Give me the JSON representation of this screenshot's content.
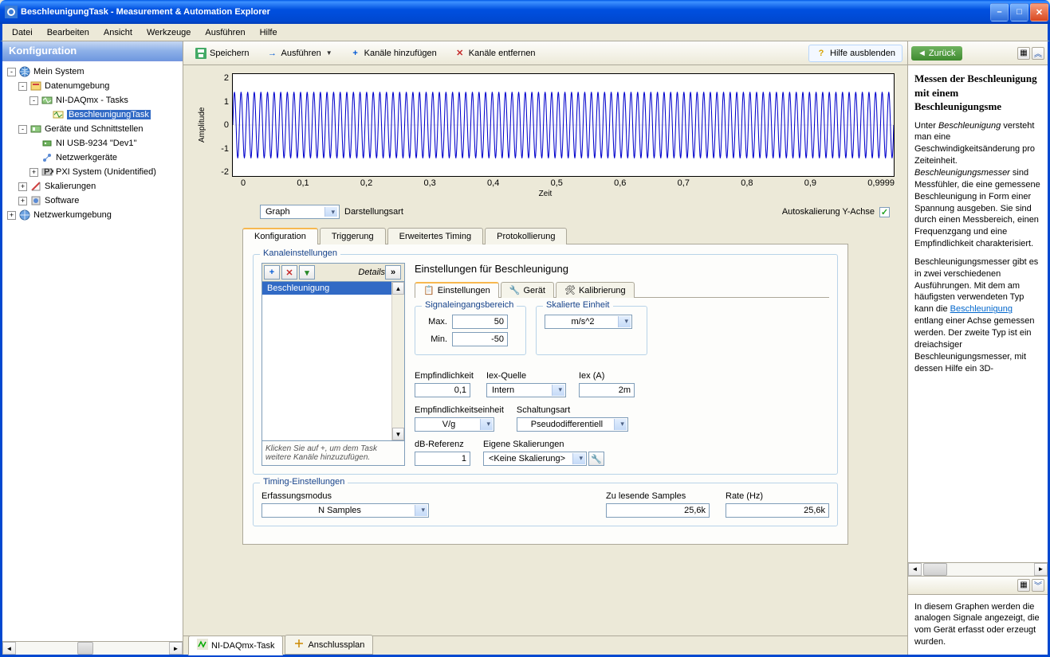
{
  "window": {
    "title": "BeschleunigungTask - Measurement & Automation Explorer"
  },
  "menubar": [
    "Datei",
    "Bearbeiten",
    "Ansicht",
    "Werkzeuge",
    "Ausführen",
    "Hilfe"
  ],
  "left": {
    "header": "Konfiguration",
    "tree": [
      {
        "indent": 0,
        "exp": "-",
        "icon": "globe-icon",
        "label": "Mein System"
      },
      {
        "indent": 1,
        "exp": "-",
        "icon": "data-icon",
        "label": "Datenumgebung"
      },
      {
        "indent": 2,
        "exp": "-",
        "icon": "daq-icon",
        "label": "NI-DAQmx - Tasks"
      },
      {
        "indent": 3,
        "exp": "",
        "icon": "task-icon",
        "label": "BeschleunigungTask",
        "selected": true
      },
      {
        "indent": 1,
        "exp": "-",
        "icon": "devices-icon",
        "label": "Geräte und Schnittstellen"
      },
      {
        "indent": 2,
        "exp": "",
        "icon": "usb-icon",
        "label": "NI USB-9234 \"Dev1\""
      },
      {
        "indent": 2,
        "exp": "",
        "icon": "net-icon",
        "label": "Netzwerkgeräte"
      },
      {
        "indent": 2,
        "exp": "+",
        "icon": "pxi-icon",
        "label": "PXI System (Unidentified)"
      },
      {
        "indent": 1,
        "exp": "+",
        "icon": "scale-icon",
        "label": "Skalierungen"
      },
      {
        "indent": 1,
        "exp": "+",
        "icon": "software-icon",
        "label": "Software"
      },
      {
        "indent": 0,
        "exp": "+",
        "icon": "netenv-icon",
        "label": "Netzwerkumgebung"
      }
    ]
  },
  "toolbar": {
    "save": "Speichern",
    "run": "Ausführen",
    "addch": "Kanäle hinzufügen",
    "remch": "Kanäle entfernen",
    "hidehelp": "Hilfe ausblenden"
  },
  "chart_data": {
    "type": "line",
    "title": "",
    "xlabel": "Zeit",
    "ylabel": "Amplitude",
    "xticks": [
      "0",
      "0,1",
      "0,2",
      "0,3",
      "0,4",
      "0,5",
      "0,6",
      "0,7",
      "0,8",
      "0,9",
      "0,9999"
    ],
    "yticks": [
      "2",
      "1",
      "0",
      "-1",
      "-2"
    ],
    "ylim": [
      -2,
      2
    ],
    "xlim": [
      0,
      1
    ],
    "series": [
      {
        "name": "Beschleunigung",
        "description": "sine wave",
        "amplitude": 1.3,
        "frequency_hz_approx": 100,
        "color": "#0000cc"
      }
    ]
  },
  "chartctrl": {
    "display_select": "Graph",
    "display_label": "Darstellungsart",
    "autoscale_label": "Autoskalierung Y-Achse",
    "autoscale_checked": true
  },
  "cfgtabs": [
    "Konfiguration",
    "Triggerung",
    "Erweitertes Timing",
    "Protokollierung"
  ],
  "channel": {
    "legend": "Kanaleinstellungen",
    "details": "Details",
    "list_item": "Beschleunigung",
    "hint": "Klicken Sie auf +, um dem Task weitere Kanäle hinzuzufügen."
  },
  "settings": {
    "title": "Einstellungen für Beschleunigung",
    "subtabs": [
      "Einstellungen",
      "Gerät",
      "Kalibrierung"
    ],
    "range_legend": "Signaleingangsbereich",
    "max_label": "Max.",
    "max_value": "50",
    "min_label": "Min.",
    "min_value": "-50",
    "unit_legend": "Skalierte Einheit",
    "unit_value": "m/s^2",
    "sens_label": "Empfindlichkeit",
    "sens_value": "0,1",
    "iexsrc_label": "Iex-Quelle",
    "iexsrc_value": "Intern",
    "iex_label": "Iex (A)",
    "iex_value": "2m",
    "sensunit_label": "Empfindlichkeitseinheit",
    "sensunit_value": "V/g",
    "term_label": "Schaltungsart",
    "term_value": "Pseudodifferentiell",
    "dbref_label": "dB-Referenz",
    "dbref_value": "1",
    "custscale_label": "Eigene Skalierungen",
    "custscale_value": "<Keine Skalierung>"
  },
  "timing": {
    "legend": "Timing-Einstellungen",
    "mode_label": "Erfassungsmodus",
    "mode_value": "N Samples",
    "samples_label": "Zu lesende Samples",
    "samples_value": "25,6k",
    "rate_label": "Rate (Hz)",
    "rate_value": "25,6k"
  },
  "bottomtabs": {
    "t1": "NI-DAQmx-Task",
    "t2": "Anschlussplan"
  },
  "help": {
    "back": "Zurück",
    "title": "Messen der Beschleunigung mit einem Beschleunigungsme",
    "p1_a": "Unter ",
    "p1_em1": "Beschleunigung",
    "p1_b": " versteht man eine Geschwindigkeitsänderung pro Zeiteinheit. ",
    "p1_em2": "Beschleunigungsmesser",
    "p1_c": " sind Messfühler, die eine gemessene Beschleunigung in Form einer Spannung ausgeben. Sie sind durch einen Messbereich, einen Frequenzgang und eine Empfindlichkeit charakterisiert.",
    "p2_a": "Beschleunigungsmesser gibt es in zwei verschiedenen Ausführungen. Mit dem am häufigsten verwendeten Typ kann die ",
    "p2_link": "Beschleunigung",
    "p2_b": " entlang einer Achse gemessen werden. Der zweite Typ ist ein dreiachsiger Beschleunigungsmesser, mit dessen Hilfe ein 3D-",
    "lower": "In diesem Graphen werden die analogen Signale angezeigt, die vom Gerät erfasst oder erzeugt wurden."
  }
}
